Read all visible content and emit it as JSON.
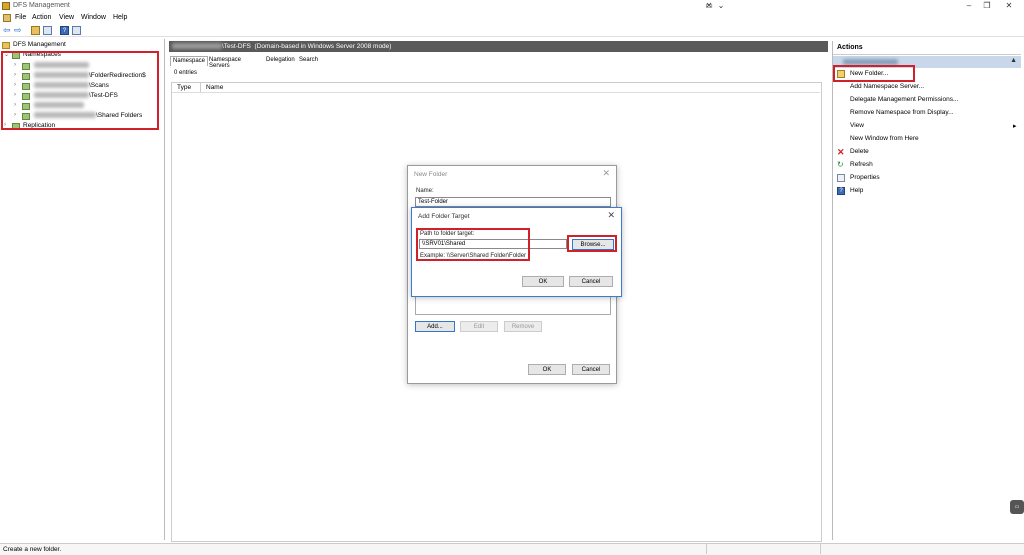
{
  "window": {
    "title": "DFS Management"
  },
  "menu": [
    "File",
    "Action",
    "View",
    "Window",
    "Help"
  ],
  "tree": {
    "root": "DFS Management",
    "namespaces": "Namespaces",
    "items": [
      {
        "suffix": ""
      },
      {
        "suffix": "\\FolderRedirection$"
      },
      {
        "suffix": "\\Scans"
      },
      {
        "suffix": "\\Test-DFS"
      },
      {
        "suffix": ""
      },
      {
        "suffix": "\\Shared Folders"
      }
    ],
    "replication": "Replication"
  },
  "center": {
    "header_title": "\\Test-DFS",
    "header_mode": "(Domain-based in Windows Server 2008 mode)",
    "tabs": [
      "Namespace",
      "Namespace Servers",
      "Delegation",
      "Search"
    ],
    "entries": "0 entries",
    "columns": [
      "Type",
      "Name"
    ]
  },
  "actions": {
    "header": "Actions",
    "items": [
      {
        "label": "New Folder...",
        "icon": "new-folder-icon"
      },
      {
        "label": "Add Namespace Server..."
      },
      {
        "label": "Delegate Management Permissions..."
      },
      {
        "label": "Remove Namespace from Display..."
      },
      {
        "label": "View",
        "submenu": true
      },
      {
        "label": "New Window from Here"
      },
      {
        "label": "Delete",
        "icon": "delete-icon"
      },
      {
        "label": "Refresh",
        "icon": "refresh-icon"
      },
      {
        "label": "Properties",
        "icon": "properties-icon"
      },
      {
        "label": "Help",
        "icon": "help-icon"
      }
    ]
  },
  "new_folder_dialog": {
    "title": "New Folder",
    "name_label": "Name:",
    "name_value": "Test-Folder",
    "add": "Add...",
    "edit": "Edit",
    "remove": "Remove",
    "ok": "OK",
    "cancel": "Cancel"
  },
  "add_target_dialog": {
    "title": "Add Folder Target",
    "path_label": "Path to folder target:",
    "path_value": "\\\\SRV01\\Shared",
    "browse": "Browse...",
    "example": "Example: \\\\Server\\Shared Folder\\Folder",
    "ok": "OK",
    "cancel": "Cancel"
  },
  "status": {
    "text": "Create a new folder."
  },
  "colors": {
    "highlight": "#d0202a",
    "header_bg": "#5a5a5a",
    "actions_subheader": "#c8d8ea"
  }
}
